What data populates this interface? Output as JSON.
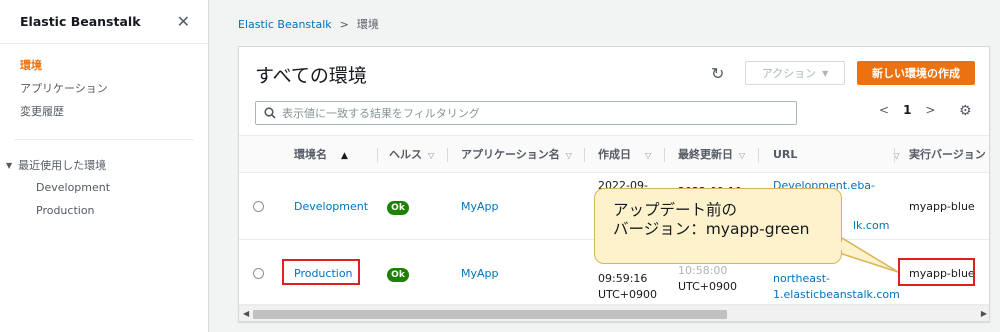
{
  "sidebar": {
    "title": "Elastic Beanstalk",
    "close": "✕",
    "nav": [
      {
        "label": "環境",
        "active": true
      },
      {
        "label": "アプリケーション",
        "active": false
      },
      {
        "label": "変更履歴",
        "active": false
      }
    ],
    "recent": {
      "label": "最近使用した環境",
      "items": [
        "Development",
        "Production"
      ]
    }
  },
  "breadcrumb": {
    "root": "Elastic Beanstalk",
    "separator": ">",
    "current": "環境"
  },
  "panel": {
    "title": "すべての環境",
    "action_label": "アクション",
    "create_label": "新しい環境の作成",
    "search_placeholder": "表示値に一致する結果をフィルタリング",
    "page": "1"
  },
  "table": {
    "columns": [
      "環境名",
      "ヘルス",
      "アプリケーション名",
      "作成日",
      "最終更新日",
      "URL",
      "実行バージョン"
    ],
    "rows": [
      {
        "env": "Development",
        "health": "Ok",
        "app": "MyApp",
        "created": [
          "2022-09-"
        ],
        "updated": [
          "2022-09-10"
        ],
        "url": [
          "Development.eba-",
          "",
          "lk.com"
        ],
        "version": "myapp-blue"
      },
      {
        "env": "Production",
        "health": "Ok",
        "app": "MyApp",
        "created": [
          "09:59:16",
          "UTC+0900"
        ],
        "updated": [
          "10:58:00",
          "UTC+0900"
        ],
        "url": [
          "northeast-",
          "1.elasticbeanstalk.com"
        ],
        "version": "myapp-blue"
      }
    ]
  },
  "callout": {
    "line1": "アップデート前の",
    "line2": "バージョン：myapp-green"
  },
  "colors": {
    "accent": "#ec7211",
    "link": "#0073bb",
    "ok": "#1d8102",
    "highlight": "#e02020",
    "callout_bg": "#fdf2cc"
  }
}
